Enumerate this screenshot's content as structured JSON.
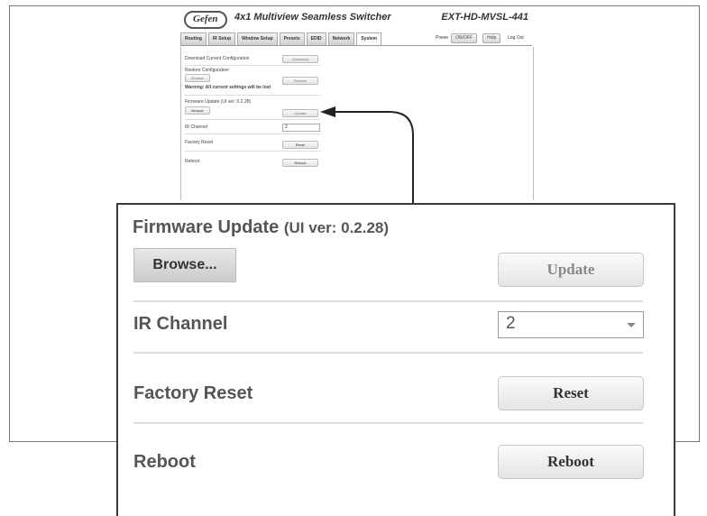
{
  "header": {
    "logo": "Gefen",
    "product": "4x1 Multiview Seamless Switcher",
    "model": "EXT-HD-MVSL-441"
  },
  "tabs": [
    "Routing",
    "IR Setup",
    "Window Setup",
    "Presets",
    "EDID",
    "Network",
    "System"
  ],
  "active_tab": "System",
  "topbar": {
    "power_label": "Power",
    "power_button": "ON/OFF",
    "help_button": "Help",
    "logout": "Log Out"
  },
  "system_small": {
    "download_config_label": "Download Current Configuration",
    "download_button": "Download",
    "restore_config_label": "Restore Configuration",
    "restore_browse": "Browse",
    "restore_button": "Restore",
    "warning": "Warning: All current settings will be lost",
    "firmware_label": "Firmware Update (UI ver: 0.2.28)",
    "firmware_browse": "Browse",
    "update_button": "Update",
    "ir_label": "IR Channel",
    "ir_value": "2",
    "factory_label": "Factory Reset",
    "reset_button": "Reset",
    "reboot_label": "Reboot",
    "reboot_button": "Reboot"
  },
  "zoom": {
    "firmware_title": "Firmware Update",
    "firmware_version": "(UI ver: 0.2.28)",
    "browse_button": "Browse...",
    "update_button": "Update",
    "ir_label": "IR Channel",
    "ir_value": "2",
    "factory_label": "Factory Reset",
    "reset_button": "Reset",
    "reboot_label": "Reboot",
    "reboot_button": "Reboot"
  }
}
